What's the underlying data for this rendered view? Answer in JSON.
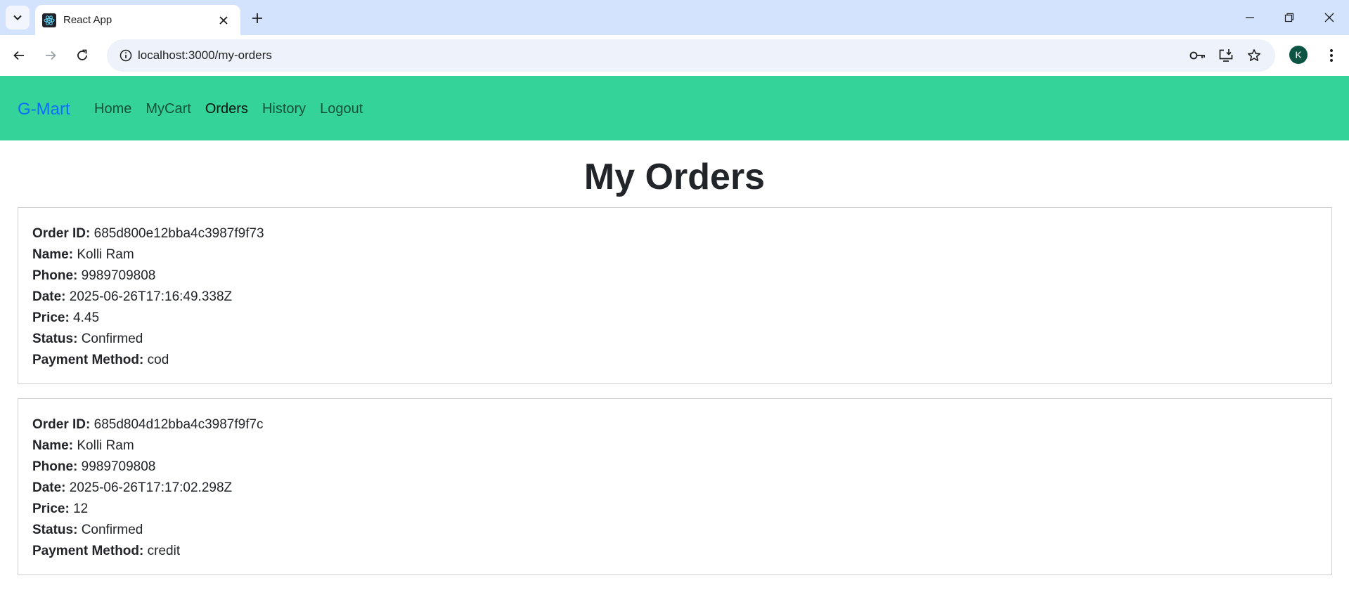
{
  "browser": {
    "tab_title": "React App",
    "url": "localhost:3000/my-orders",
    "profile_initial": "K"
  },
  "navbar": {
    "brand": "G-Mart",
    "links": [
      "Home",
      "MyCart",
      "Orders",
      "History",
      "Logout"
    ],
    "active": "Orders"
  },
  "page": {
    "title": "My Orders"
  },
  "labels": {
    "order_id": "Order ID:",
    "name": "Name:",
    "phone": "Phone:",
    "date": "Date:",
    "price": "Price:",
    "status": "Status:",
    "payment_method": "Payment Method:"
  },
  "orders": [
    {
      "order_id": "685d800e12bba4c3987f9f73",
      "name": "Kolli Ram",
      "phone": "9989709808",
      "date": "2025-06-26T17:16:49.338Z",
      "price": "4.45",
      "status": "Confirmed",
      "payment_method": "cod"
    },
    {
      "order_id": "685d804d12bba4c3987f9f7c",
      "name": "Kolli Ram",
      "phone": "9989709808",
      "date": "2025-06-26T17:17:02.298Z",
      "price": "12",
      "status": "Confirmed",
      "payment_method": "credit"
    }
  ],
  "colors": {
    "navbar_bg": "#34d399",
    "brand": "#0d6efd",
    "tabstrip_bg": "#d3e3fd"
  },
  "icons": {
    "tab_search": "chevron-down-icon",
    "favicon": "react-icon",
    "tab_close": "close-icon",
    "new_tab": "plus-icon",
    "back": "back-arrow-icon",
    "forward": "forward-arrow-icon",
    "reload": "reload-icon",
    "site_info": "info-icon",
    "password": "key-icon",
    "install": "install-app-icon",
    "bookmark": "star-icon",
    "menu": "kebab-menu-icon"
  }
}
